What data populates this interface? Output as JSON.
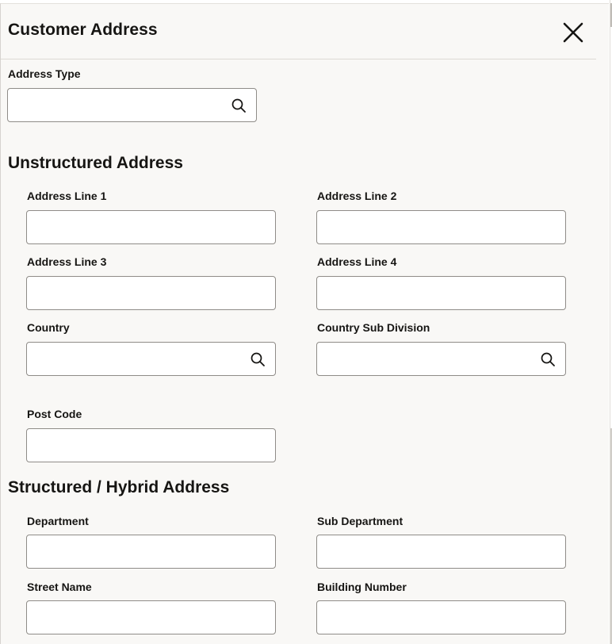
{
  "dialog": {
    "title": "Customer Address",
    "close_icon": "close-icon"
  },
  "address_type": {
    "label": "Address Type",
    "value": "",
    "icon": "search-icon"
  },
  "unstructured": {
    "title": "Unstructured Address",
    "address_line_1": {
      "label": "Address Line 1",
      "value": ""
    },
    "address_line_2": {
      "label": "Address Line 2",
      "value": ""
    },
    "address_line_3": {
      "label": "Address Line 3",
      "value": ""
    },
    "address_line_4": {
      "label": "Address Line 4",
      "value": ""
    },
    "country": {
      "label": "Country",
      "value": "",
      "icon": "search-icon"
    },
    "country_sub_division": {
      "label": "Country Sub Division",
      "value": "",
      "icon": "search-icon"
    },
    "post_code": {
      "label": "Post Code",
      "value": ""
    }
  },
  "structured": {
    "title": "Structured / Hybrid Address",
    "department": {
      "label": "Department",
      "value": ""
    },
    "sub_department": {
      "label": "Sub Department",
      "value": ""
    },
    "street_name": {
      "label": "Street Name",
      "value": ""
    },
    "building_number": {
      "label": "Building Number",
      "value": ""
    }
  },
  "colors": {
    "panel_background": "#f9f8f6",
    "field_border": "#8f8c88",
    "text": "#161513"
  }
}
